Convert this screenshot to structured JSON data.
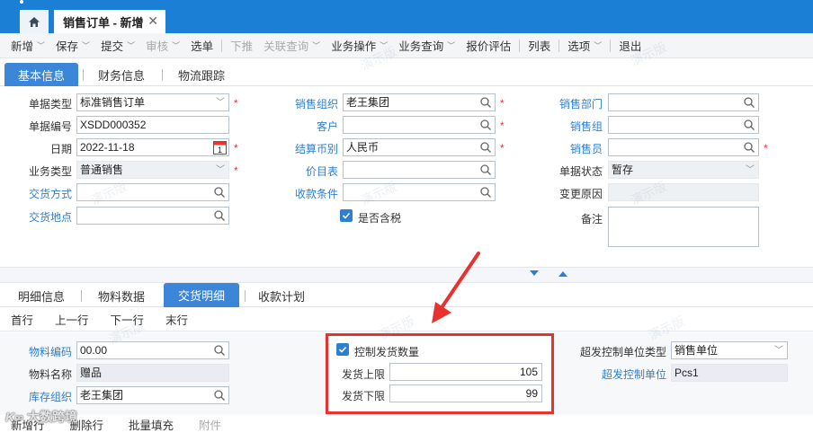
{
  "window": {
    "doc_tab": "销售订单 - 新增",
    "home_icon": "home-icon",
    "close_icon": "close-icon"
  },
  "toolbar": [
    {
      "label": "新增",
      "dropdown": true,
      "disabled": false
    },
    {
      "label": "保存",
      "dropdown": true,
      "disabled": false
    },
    {
      "label": "提交",
      "dropdown": true,
      "disabled": false
    },
    {
      "label": "审核",
      "dropdown": true,
      "disabled": true
    },
    {
      "label": "选单",
      "dropdown": false,
      "disabled": false
    },
    {
      "label": "下推",
      "dropdown": false,
      "disabled": true
    },
    {
      "label": "关联查询",
      "dropdown": true,
      "disabled": true
    },
    {
      "label": "业务操作",
      "dropdown": true,
      "disabled": false
    },
    {
      "label": "业务查询",
      "dropdown": true,
      "disabled": false
    },
    {
      "label": "报价评估",
      "dropdown": false,
      "disabled": false
    },
    {
      "label": "列表",
      "dropdown": false,
      "disabled": false
    },
    {
      "label": "选项",
      "dropdown": true,
      "disabled": false
    },
    {
      "label": "退出",
      "dropdown": false,
      "disabled": false
    }
  ],
  "header_tabs": [
    "基本信息",
    "财务信息",
    "物流跟踪"
  ],
  "form": {
    "bill_type": {
      "label": "单据类型",
      "value": "标准销售订单"
    },
    "bill_no": {
      "label": "单据编号",
      "value": "XSDD000352"
    },
    "date": {
      "label": "日期",
      "value": "2022-11-18",
      "calendar_day": "1"
    },
    "biz_type": {
      "label": "业务类型",
      "value": "普通销售"
    },
    "delivery_method": {
      "label": "交货方式",
      "value": ""
    },
    "delivery_place": {
      "label": "交货地点",
      "value": ""
    },
    "sales_org": {
      "label": "销售组织",
      "value": "老王集团"
    },
    "customer": {
      "label": "客户",
      "value": ""
    },
    "currency": {
      "label": "结算币别",
      "value": "人民币"
    },
    "price_list": {
      "label": "价目表",
      "value": ""
    },
    "payment_terms": {
      "label": "收款条件",
      "value": ""
    },
    "tax_included": {
      "label": "是否含税",
      "checked": true
    },
    "sales_dept": {
      "label": "销售部门",
      "value": ""
    },
    "sales_group": {
      "label": "销售组",
      "value": ""
    },
    "salesman": {
      "label": "销售员",
      "value": ""
    },
    "status": {
      "label": "单据状态",
      "value": "暂存"
    },
    "change_reason": {
      "label": "变更原因",
      "value": ""
    },
    "remark": {
      "label": "备注",
      "value": ""
    }
  },
  "detail_tabs": [
    "明细信息",
    "物料数据",
    "交货明细",
    "收款计划"
  ],
  "row_nav": [
    "首行",
    "上一行",
    "下一行",
    "末行"
  ],
  "detail": {
    "material_code": {
      "label": "物料编码",
      "value": "00.00"
    },
    "material_name": {
      "label": "物料名称",
      "value": "赠品"
    },
    "stock_org": {
      "label": "库存组织",
      "value": "老王集团"
    },
    "control_qty": {
      "label": "控制发货数量",
      "checked": true
    },
    "upper_limit": {
      "label": "发货上限",
      "value": "105"
    },
    "lower_limit": {
      "label": "发货下限",
      "value": "99"
    },
    "over_unit_type": {
      "label": "超发控制单位类型",
      "value": "销售单位"
    },
    "over_unit": {
      "label": "超发控制单位",
      "value": "Pcs1"
    }
  },
  "bottom_actions": [
    {
      "label": "新增行",
      "disabled": false
    },
    {
      "label": "删除行",
      "disabled": false
    },
    {
      "label": "批量填充",
      "disabled": false
    },
    {
      "label": "附件",
      "disabled": true
    }
  ],
  "watermark_text": "演示版",
  "logo_text": "大数跨境"
}
